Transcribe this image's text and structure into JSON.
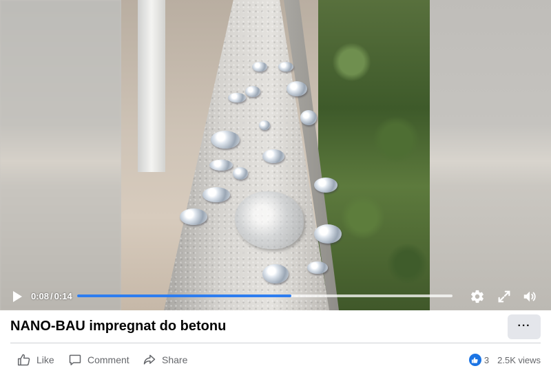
{
  "player": {
    "current_time": "0:08",
    "duration": "0:14",
    "time_separator": "/",
    "progress_fraction": 0.57,
    "accent_color": "#2d7df0",
    "icons": {
      "play": "play-icon",
      "settings": "gear-icon",
      "fullscreen": "expand-icon",
      "volume": "speaker-icon"
    }
  },
  "post": {
    "title": "NANO-BAU impregnat do betonu",
    "more_label": "···"
  },
  "actions": {
    "like_label": "Like",
    "comment_label": "Comment",
    "share_label": "Share"
  },
  "stats": {
    "reaction_count": "3",
    "views": "2.5K views"
  }
}
